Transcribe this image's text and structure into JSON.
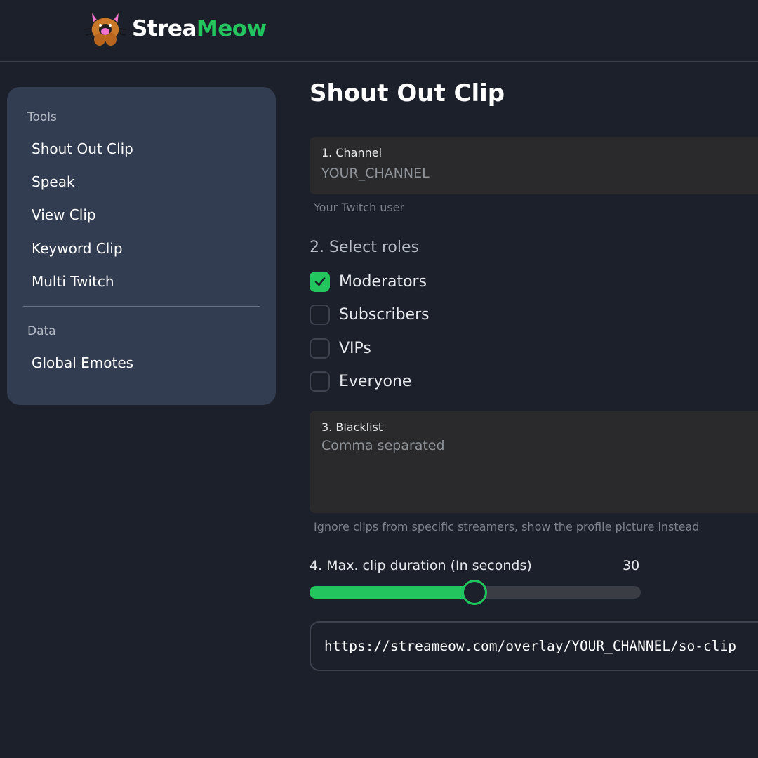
{
  "app": {
    "logo_text_part1": "Strea",
    "logo_text_part2": "Meow"
  },
  "sidebar": {
    "sections": [
      {
        "label": "Tools",
        "items": [
          "Shout Out Clip",
          "Speak",
          "View Clip",
          "Keyword Clip",
          "Multi Twitch"
        ]
      },
      {
        "label": "Data",
        "items": [
          "Global Emotes"
        ]
      }
    ]
  },
  "main": {
    "title": "Shout Out Clip",
    "channel": {
      "label": "1. Channel",
      "placeholder": "YOUR_CHANNEL",
      "value": "",
      "helper": "Your Twitch user"
    },
    "roles": {
      "title": "2. Select roles",
      "options": [
        {
          "label": "Moderators",
          "checked": true
        },
        {
          "label": "Subscribers",
          "checked": false
        },
        {
          "label": "VIPs",
          "checked": false
        },
        {
          "label": "Everyone",
          "checked": false
        }
      ]
    },
    "blacklist": {
      "label": "3. Blacklist",
      "placeholder": "Comma separated",
      "value": "",
      "helper": "Ignore clips from specific streamers, show the profile picture instead"
    },
    "duration": {
      "label": "4. Max. clip duration (In seconds)",
      "value": "30",
      "fraction": 0.46
    },
    "overlay_url": "https://streameow.com/overlay/YOUR_CHANNEL/so-clip"
  },
  "colors": {
    "background": "#1b202b",
    "sidebar": "#323d51",
    "accent": "#22c55e",
    "field": "#2a2a2c"
  },
  "icons": {
    "logo": "cat-face-icon",
    "check": "checkmark-icon"
  }
}
